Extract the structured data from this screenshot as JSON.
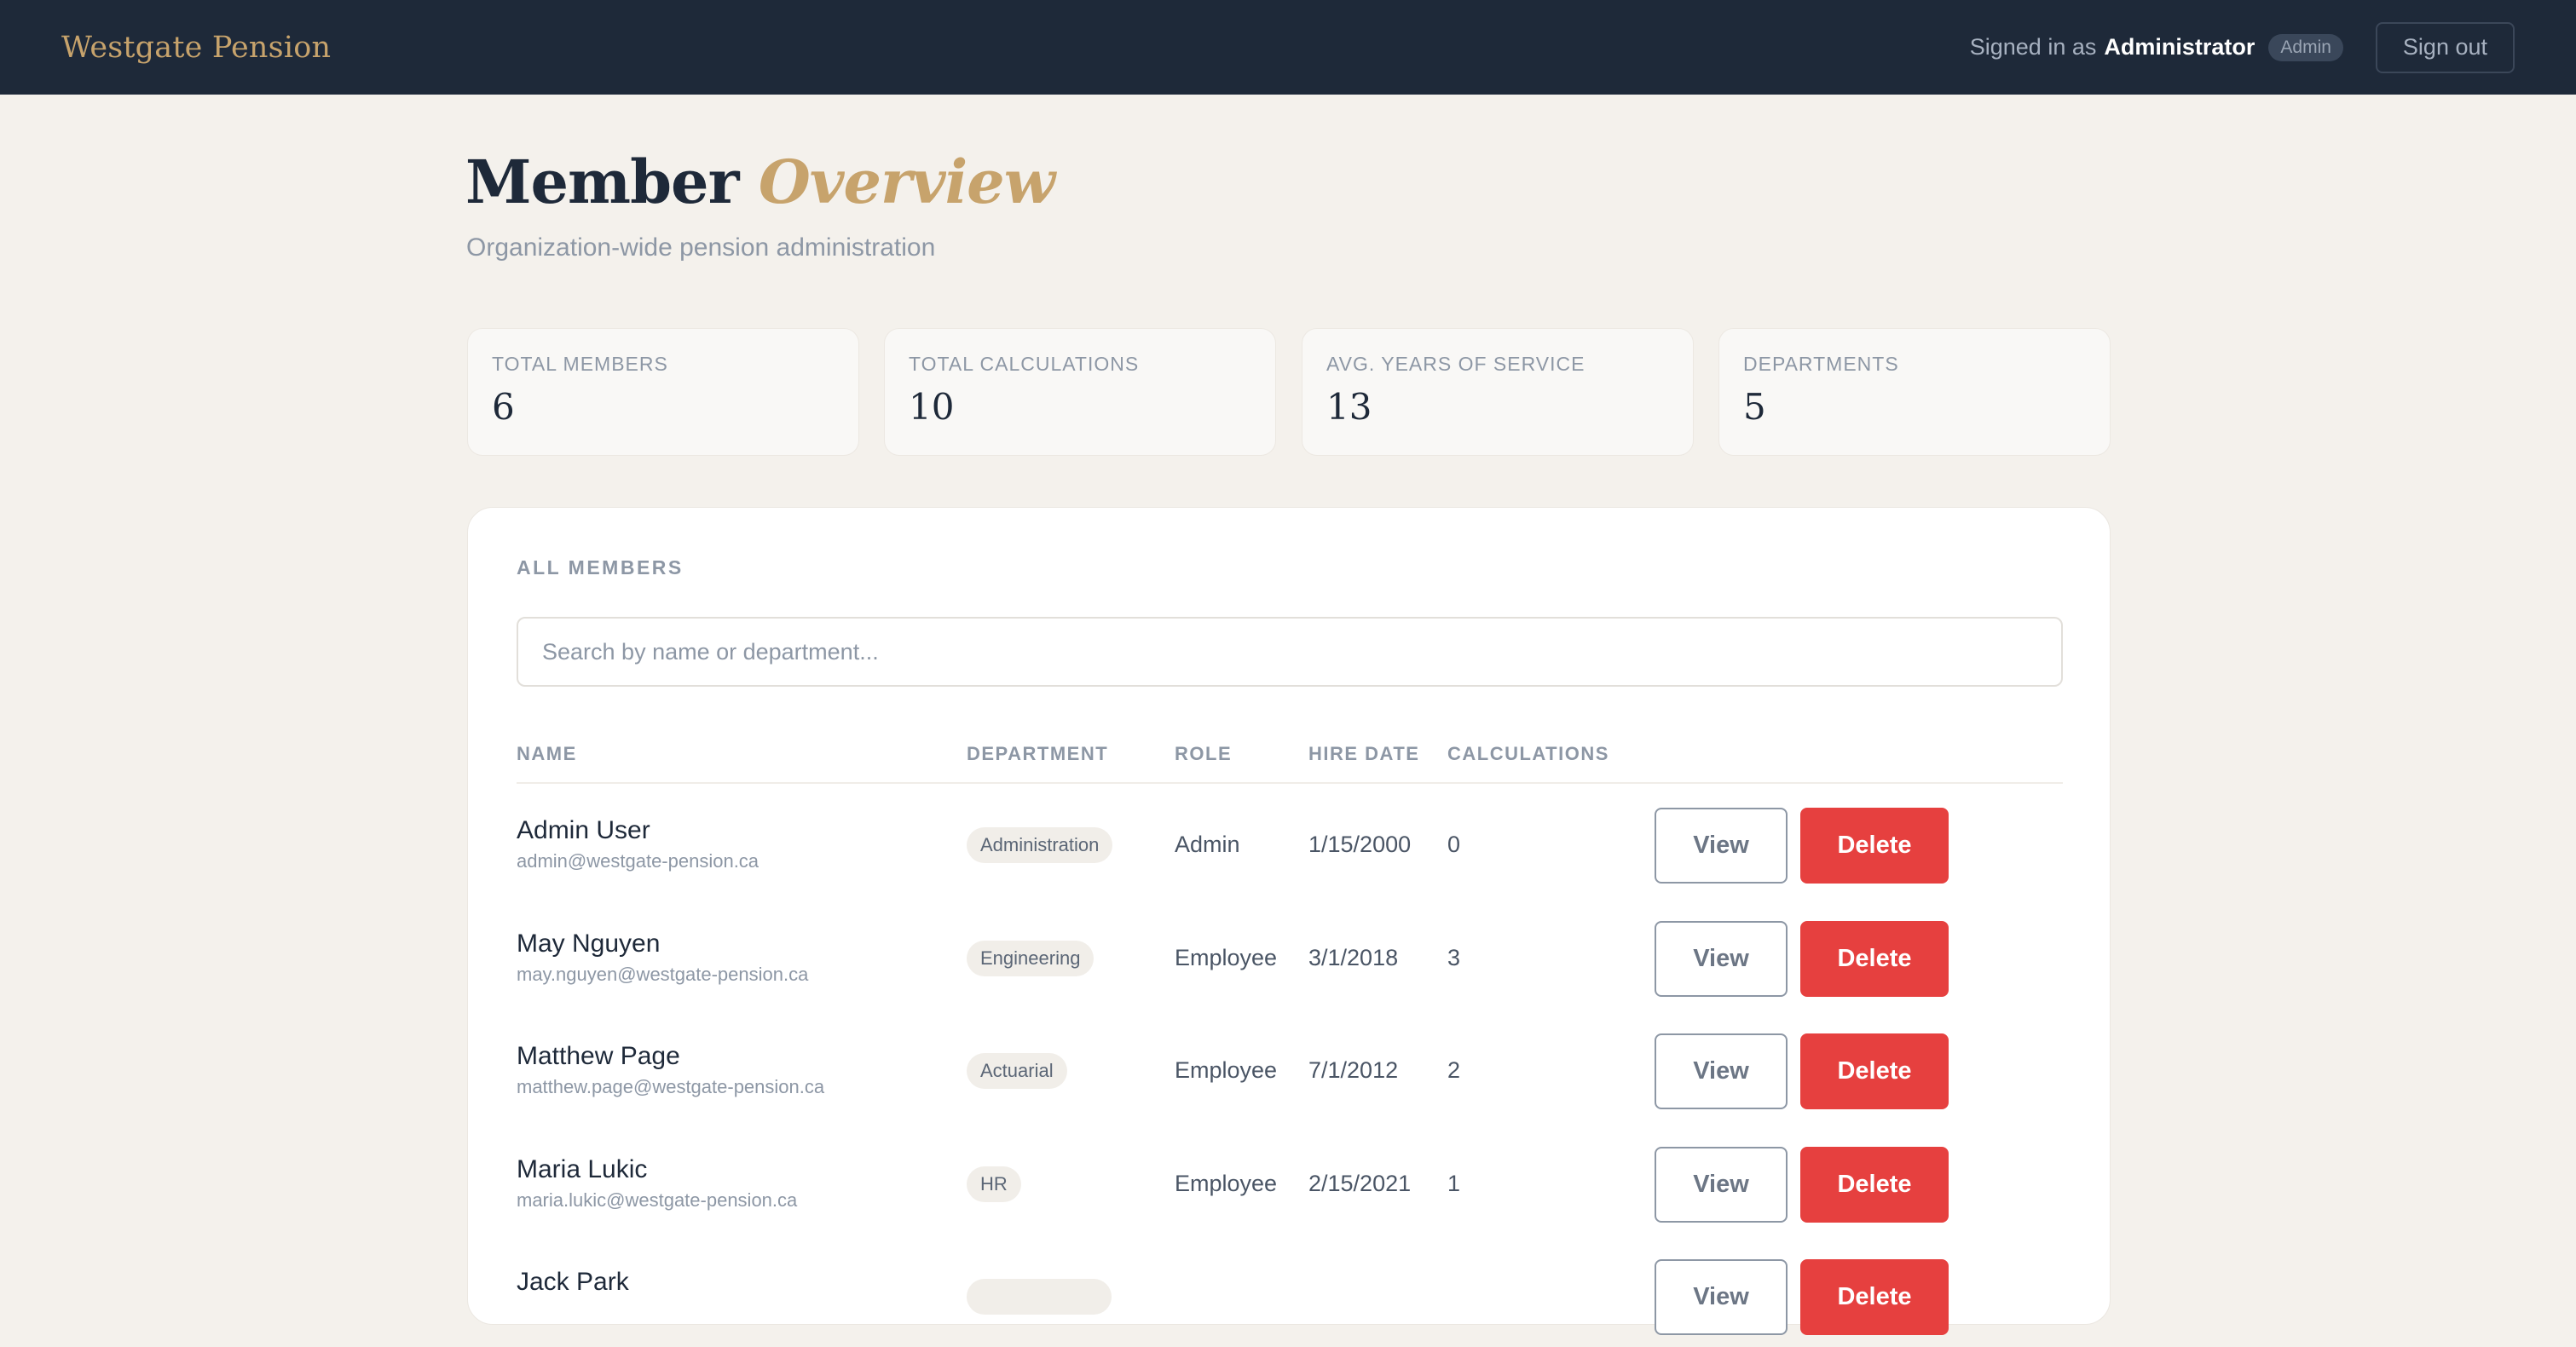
{
  "topbar": {
    "brand": "Westgate Pension",
    "signed_in_prefix": "Signed in as",
    "user_name": "Administrator",
    "role_badge": "Admin",
    "sign_out_label": "Sign out"
  },
  "header": {
    "title_main": "Member",
    "title_accent": "Overview",
    "subtitle": "Organization-wide pension administration"
  },
  "stats": [
    {
      "label": "TOTAL MEMBERS",
      "value": "6"
    },
    {
      "label": "TOTAL CALCULATIONS",
      "value": "10"
    },
    {
      "label": "AVG. YEARS OF SERVICE",
      "value": "13"
    },
    {
      "label": "DEPARTMENTS",
      "value": "5"
    }
  ],
  "members_panel": {
    "title": "ALL MEMBERS",
    "search_placeholder": "Search by name or department...",
    "search_value": "",
    "columns": [
      "NAME",
      "DEPARTMENT",
      "ROLE",
      "HIRE DATE",
      "CALCULATIONS"
    ],
    "view_label": "View",
    "delete_label": "Delete",
    "rows": [
      {
        "name": "Admin User",
        "email": "admin@westgate-pension.ca",
        "department": "Administration",
        "role": "Admin",
        "hire_date": "1/15/2000",
        "calculations": "0"
      },
      {
        "name": "May Nguyen",
        "email": "may.nguyen@westgate-pension.ca",
        "department": "Engineering",
        "role": "Employee",
        "hire_date": "3/1/2018",
        "calculations": "3"
      },
      {
        "name": "Matthew Page",
        "email": "matthew.page@westgate-pension.ca",
        "department": "Actuarial",
        "role": "Employee",
        "hire_date": "7/1/2012",
        "calculations": "2"
      },
      {
        "name": "Maria Lukic",
        "email": "maria.lukic@westgate-pension.ca",
        "department": "HR",
        "role": "Employee",
        "hire_date": "2/15/2021",
        "calculations": "1"
      },
      {
        "name": "Jack Park",
        "email": "",
        "department": "",
        "role": "",
        "hire_date": "",
        "calculations": ""
      }
    ]
  },
  "colors": {
    "topbar_bg": "#1e2939",
    "brand_gold": "#c7a36c",
    "page_bg": "#f4f1ec",
    "delete_red": "#e6403f"
  }
}
